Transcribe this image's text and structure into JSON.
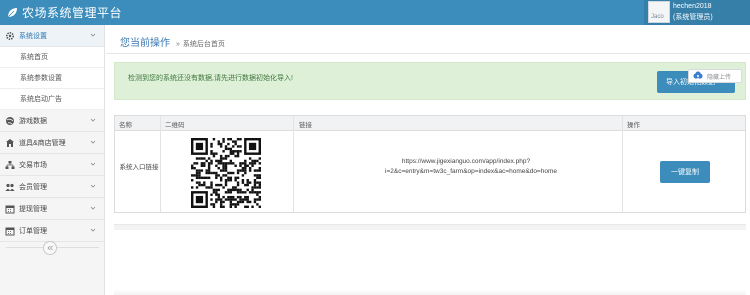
{
  "header": {
    "app_title": "农场系统管理平台",
    "avatar_text": "Jaco",
    "user_name": "hechen2018",
    "user_role": "(系统管理员)"
  },
  "sidebar": {
    "groups": [
      {
        "label": "系统设置",
        "icon": "gear-icon",
        "active": true
      },
      {
        "label": "游戏数据",
        "icon": "globe-icon"
      },
      {
        "label": "道具&商店管理",
        "icon": "shop-icon"
      },
      {
        "label": "交易市场",
        "icon": "hierarchy-icon"
      },
      {
        "label": "会员管理",
        "icon": "users-icon"
      },
      {
        "label": "提现管理",
        "icon": "calendar-icon"
      },
      {
        "label": "订单管理",
        "icon": "calendar-icon"
      }
    ],
    "sub_items": [
      "系统首页",
      "系统参数设置",
      "系统启动广告"
    ]
  },
  "breadcrumb": {
    "current": "您当前操作",
    "separator": "»",
    "page": "系统后台首页"
  },
  "alert": {
    "message": "检测到您的系统还没有数据,请先进行数据初始化导入!",
    "import_button": "导入初始化数据"
  },
  "float_widget": {
    "label": "隐藏上传"
  },
  "table": {
    "headers": [
      "名称",
      "二维码",
      "链接",
      "操作"
    ],
    "row": {
      "name": "系统入口链接",
      "link": "https://www.jigexianguo.com/app/index.php?i=2&c=entry&m=tw3c_farm&op=index&ac=home&do=home",
      "action": "一键复制"
    }
  },
  "colors": {
    "header_bg": "#3c8dbc",
    "alert_bg": "#dff0d8",
    "button_bg": "#3c8dbc",
    "breadcrumb_text": "#3a78b4"
  }
}
